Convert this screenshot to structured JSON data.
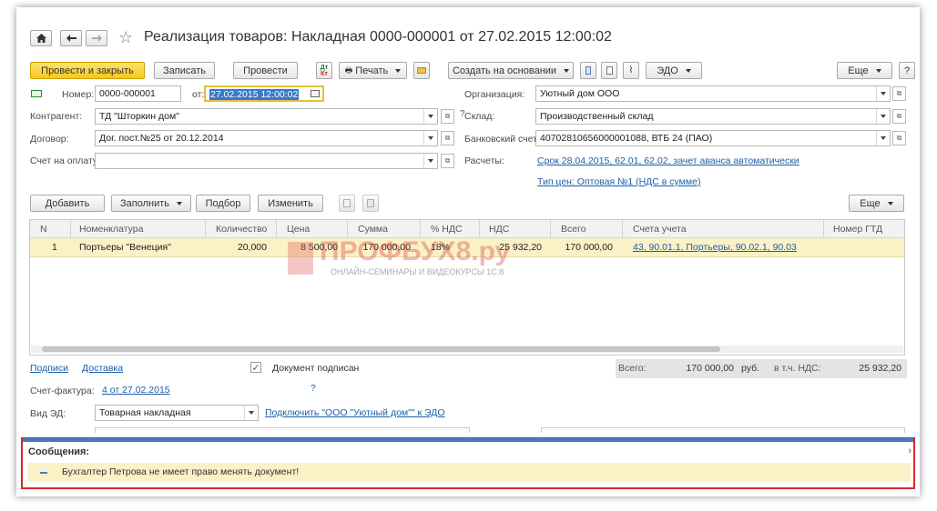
{
  "window": {
    "title": "Реализация товаров: Накладная 0000-000001 от 27.02.2015 12:00:02"
  },
  "toolbar": {
    "post_close": "Провести и закрыть",
    "save": "Записать",
    "post": "Провести",
    "print": "Печать",
    "create_based": "Создать на основании",
    "edo": "ЭДО",
    "more": "Еще",
    "help": "?"
  },
  "form": {
    "number_label": "Номер:",
    "number_value": "0000-000001",
    "date_label": "от:",
    "date_value": "27.02.2015 12:00:02",
    "counterparty_label": "Контрагент:",
    "counterparty_value": "ТД \"Шторкин дом\"",
    "contract_label": "Договор:",
    "contract_value": "Дог. пост.№25 от 20.12.2014",
    "invoice_pay_label": "Счет на оплату:",
    "invoice_pay_value": "",
    "org_label": "Организация:",
    "org_value": "Уютный дом ООО",
    "warehouse_label": "Склад:",
    "warehouse_value": "Производственный склад",
    "bank_label": "Банковский счет:",
    "bank_value": "40702810656000001088, ВТБ 24 (ПАО)",
    "settlements_label": "Расчеты:",
    "settlements_link": "Срок 28.04.2015, 62.01, 62.02, зачет аванса автоматически",
    "price_type_link": "Тип цен: Оптовая №1 (НДС в сумме)",
    "help_q": "?"
  },
  "table_toolbar": {
    "add": "Добавить",
    "fill": "Заполнить",
    "select": "Подбор",
    "change": "Изменить",
    "more": "Еще"
  },
  "table": {
    "columns": [
      "N",
      "Номенклатура",
      "Количество",
      "Цена",
      "Сумма",
      "% НДС",
      "НДС",
      "Всего",
      "Счета учета",
      "Номер ГТД"
    ],
    "rows": [
      {
        "n": "1",
        "item": "Портьеры \"Венеция\"",
        "qty": "20,000",
        "price": "8 500,00",
        "sum": "170 000,00",
        "vat_rate": "18%",
        "vat": "25 932,20",
        "total": "170 000,00",
        "accounts": "43, 90.01.1, Портьеры, 90.02.1, 90.03",
        "gtd": ""
      }
    ]
  },
  "watermark": {
    "brand": "ПРОФБУХ8.ру",
    "tagline": "ОНЛАЙН-СЕМИНАРЫ И ВИДЕОКУРСЫ 1С:8"
  },
  "footer": {
    "signers_link": "Подписи",
    "delivery_link": "Доставка",
    "signed_label": "Документ подписан",
    "total_label": "Всего:",
    "total_value": "170 000,00",
    "currency": "руб.",
    "vat_incl_label": "в т.ч. НДС:",
    "vat_value": "25 932,20",
    "invoice_label": "Счет-фактура:",
    "invoice_link": "4 от 27.02.2015",
    "invoice_q": "?",
    "ed_type_label": "Вид ЭД:",
    "ed_type_value": "Товарная накладная",
    "connect_link": "Подключить \"ООО \"Уютный дом\"\" к ЭДО"
  },
  "messages": {
    "title": "Сообщения:",
    "text": "Бухгалтер Петрова не имеет право менять документ!",
    "collapse": "›"
  },
  "colors": {
    "accent": "#f7c81c",
    "row_highlight": "#fbf1c7",
    "message_border": "#d8262b",
    "link": "#1c5ea8"
  }
}
